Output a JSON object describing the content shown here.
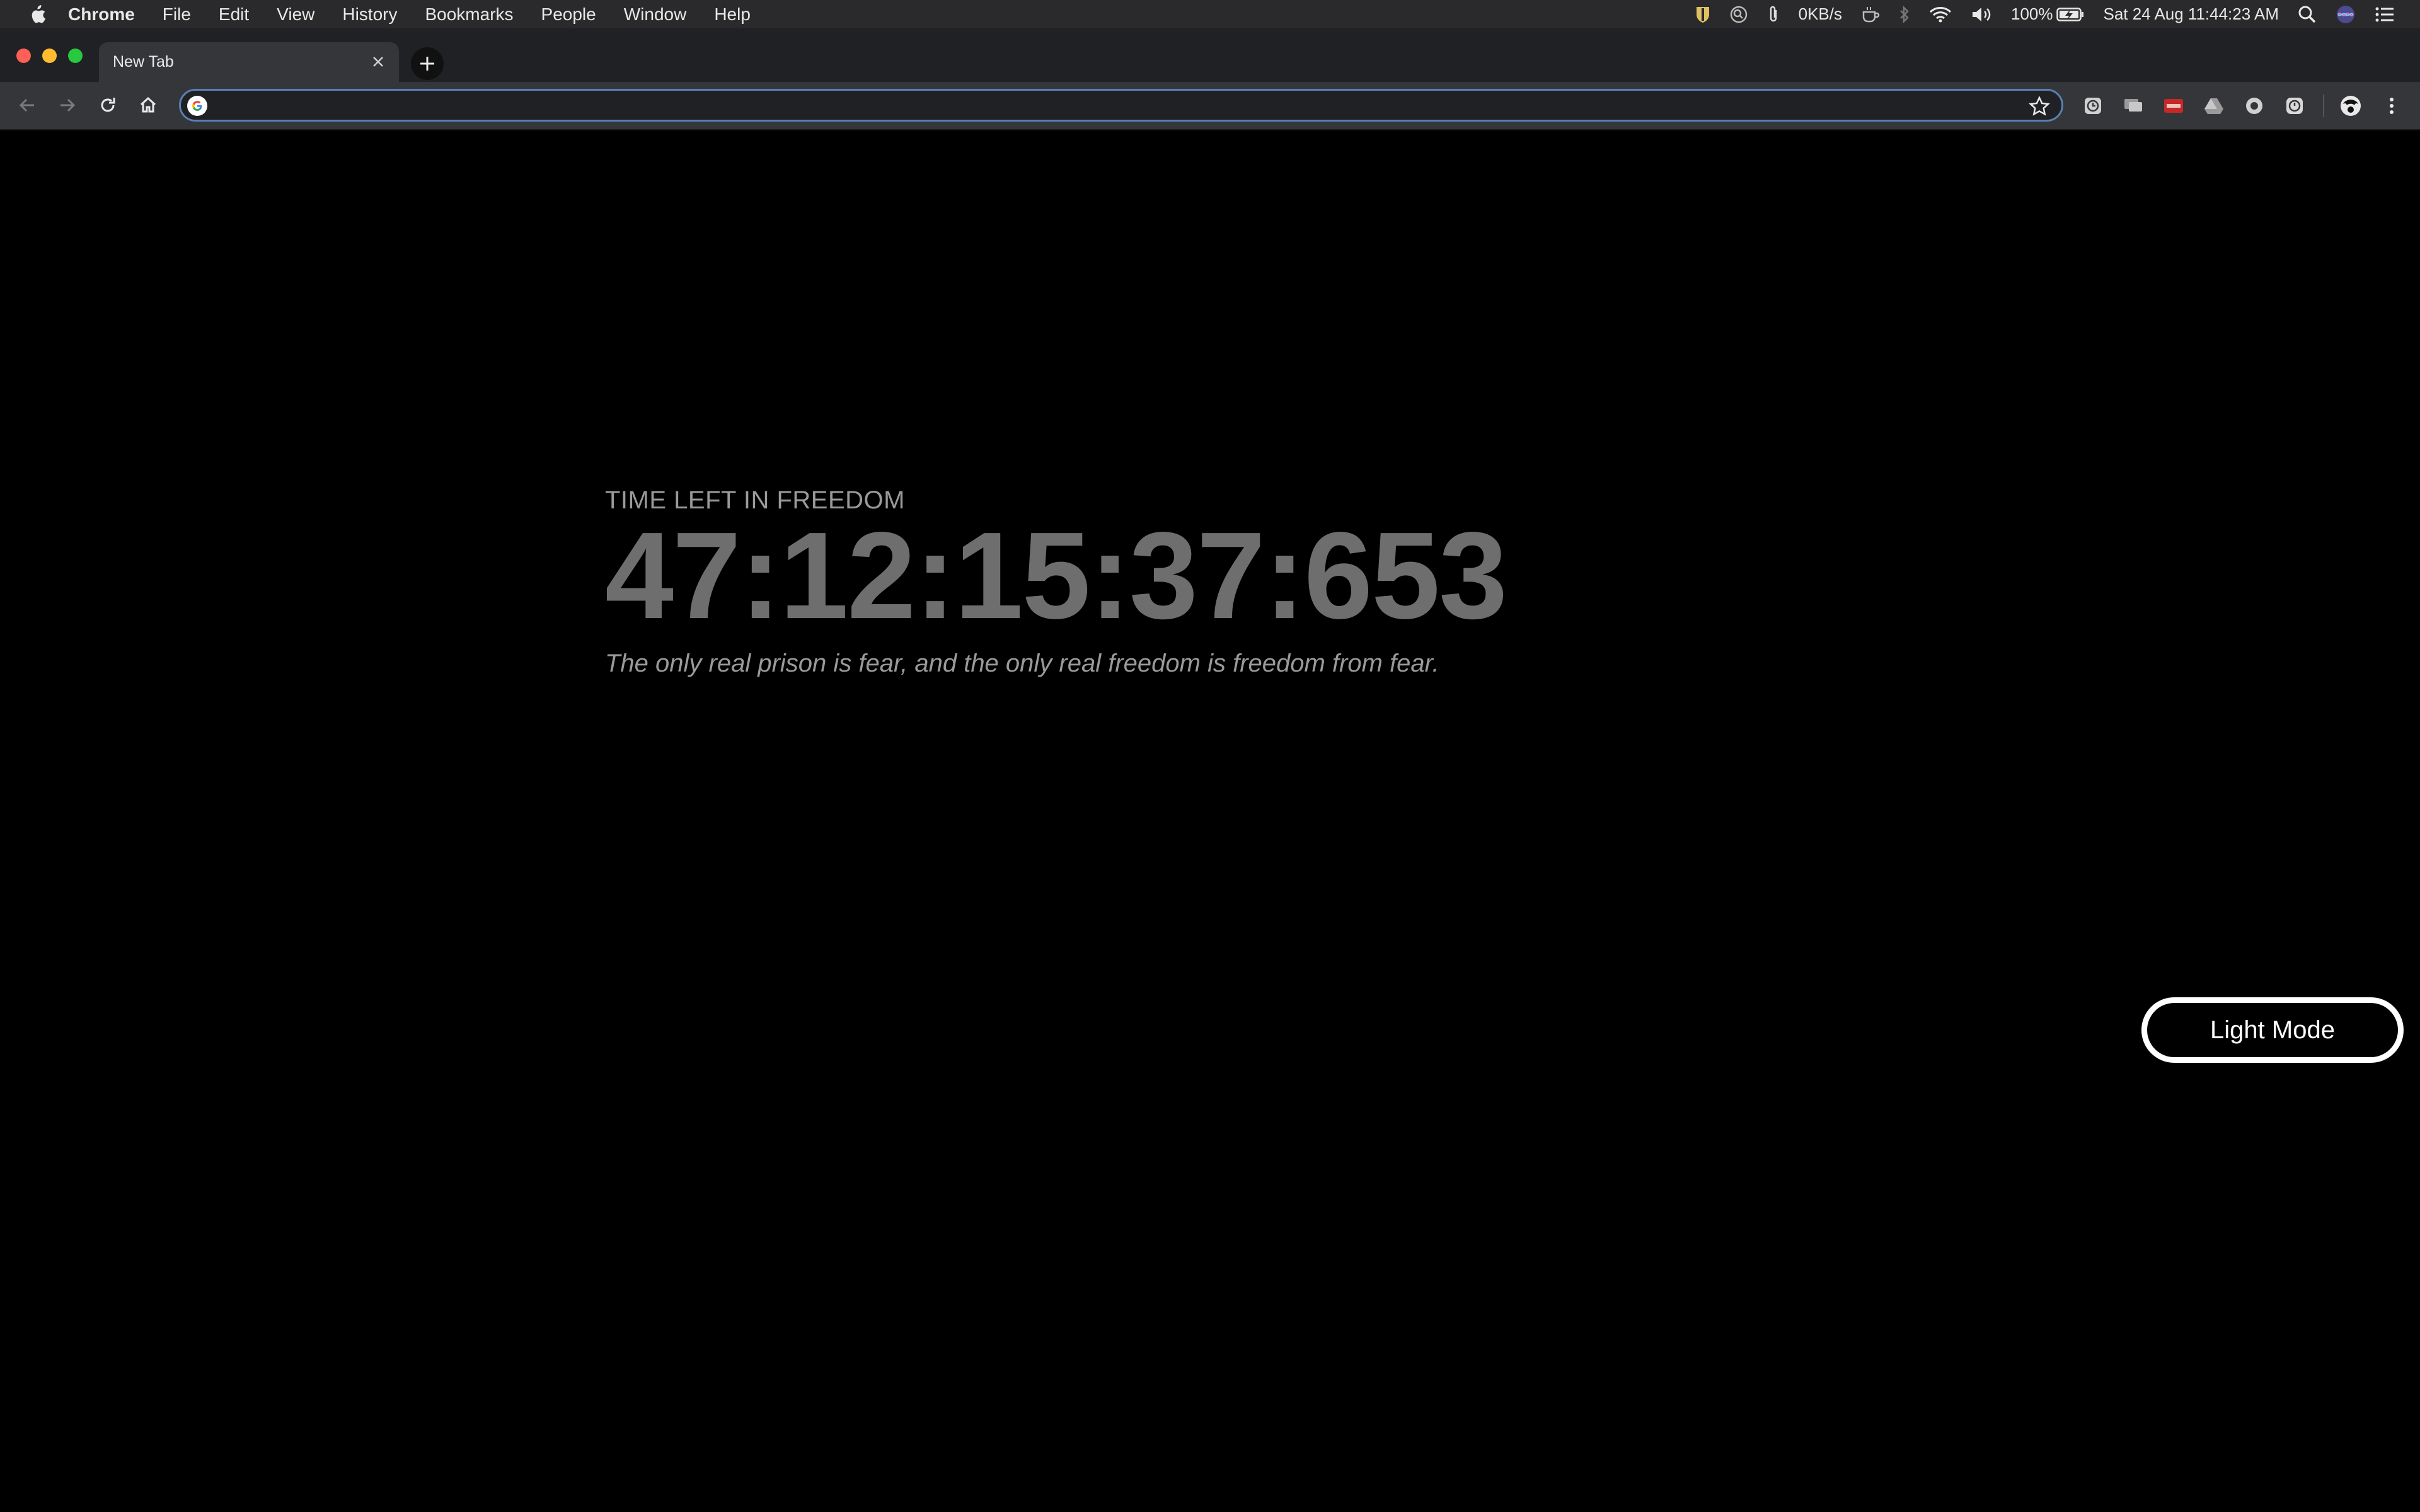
{
  "menubar": {
    "app_name": "Chrome",
    "items": [
      "File",
      "Edit",
      "View",
      "History",
      "Bookmarks",
      "People",
      "Window",
      "Help"
    ],
    "status": {
      "network_speed": "0KB/s",
      "battery": "100%",
      "datetime": "Sat 24 Aug  11:44:23 AM"
    }
  },
  "browser": {
    "tab": {
      "title": "New Tab"
    },
    "omnibox": {
      "value": ""
    }
  },
  "countdown": {
    "heading": "TIME LEFT IN FREEDOM",
    "timer": "47:12:15:37:653",
    "quote": "The only real prison is fear, and the only real freedom is freedom from fear."
  },
  "theme_toggle": {
    "label": "Light Mode"
  },
  "colors": {
    "page_background": "#000000",
    "timer_text": "#6e6e6e",
    "heading_text": "#9a9a9a",
    "toolbar": "#35363a",
    "tabstrip": "#202124",
    "omnibox_focus_ring": "#5a7fb4"
  },
  "icons": {
    "menubar": [
      "apple-icon",
      "shield-icon",
      "magnifier-circle-icon",
      "paperclip-icon",
      "coffee-icon",
      "bluetooth-icon",
      "wifi-icon",
      "volume-icon",
      "battery-charging-icon",
      "spotlight-search-icon",
      "siri-icon",
      "notification-center-icon"
    ],
    "toolbar": [
      "back-arrow-icon",
      "forward-arrow-icon",
      "reload-icon",
      "home-icon",
      "google-g-icon",
      "bookmark-star-icon",
      "profile-avatar-icon",
      "more-vertical-icon"
    ],
    "extensions": [
      "clock-extension-icon",
      "chat-extension-icon",
      "cors-extension-icon",
      "drive-extension-icon",
      "record-extension-icon",
      "timer-extension-icon"
    ]
  }
}
